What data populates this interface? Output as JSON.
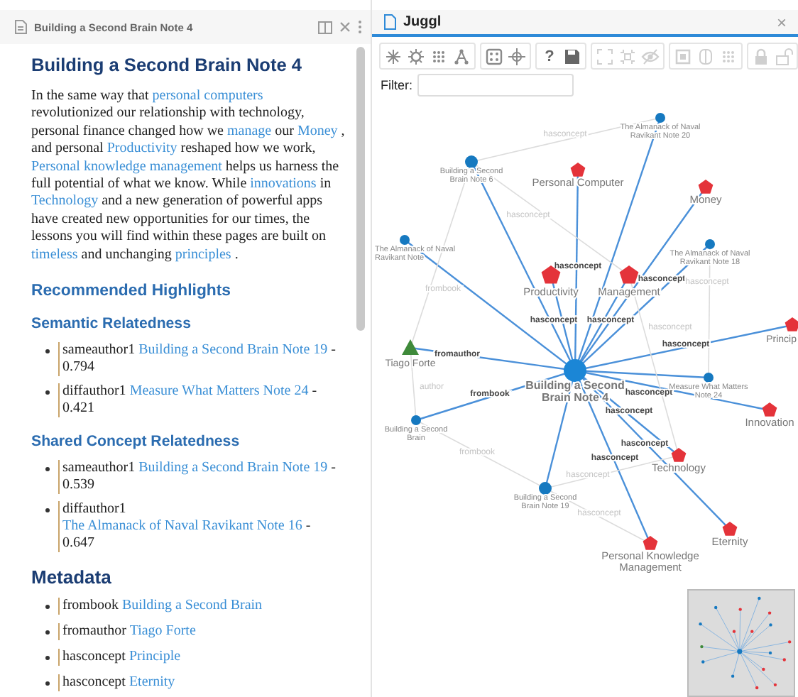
{
  "note_tab": {
    "title": "Building a Second Brain Note 4"
  },
  "note": {
    "title": "Building a Second Brain Note 4",
    "paragraph": [
      {
        "kind": "text",
        "text": "In the same way that "
      },
      {
        "kind": "link",
        "text": "personal computers"
      },
      {
        "kind": "text",
        "text": " revolutionized our relationship with technology, personal finance changed how we "
      },
      {
        "kind": "link",
        "text": "manage"
      },
      {
        "kind": "text",
        "text": " our "
      },
      {
        "kind": "link",
        "text": "Money"
      },
      {
        "kind": "text",
        "text": " , and personal "
      },
      {
        "kind": "link",
        "text": "Productivity"
      },
      {
        "kind": "text",
        "text": " reshaped how we work, "
      },
      {
        "kind": "link",
        "text": "Personal knowledge management"
      },
      {
        "kind": "text",
        "text": " helps us harness the full potential of what we know. While "
      },
      {
        "kind": "link",
        "text": "innovations"
      },
      {
        "kind": "text",
        "text": " in "
      },
      {
        "kind": "link",
        "text": "Technology"
      },
      {
        "kind": "text",
        "text": " and a new generation of powerful apps have created new opportunities for our times, the lessons you will find within these pages are built on "
      },
      {
        "kind": "link",
        "text": "timeless"
      },
      {
        "kind": "text",
        "text": " and unchanging "
      },
      {
        "kind": "link",
        "text": "principles"
      },
      {
        "kind": "text",
        "text": " ."
      }
    ],
    "highlights_heading": "Recommended Highlights",
    "sections": [
      {
        "heading": "Semantic Relatedness",
        "items": [
          {
            "relation": "sameauthor1",
            "link": "Building a Second Brain Note 19",
            "score": "- 0.794"
          },
          {
            "relation": "diffauthor1",
            "link": "Measure What Matters Note 24",
            "score": "- 0.421"
          }
        ]
      },
      {
        "heading": "Shared Concept Relatedness",
        "items": [
          {
            "relation": "sameauthor1",
            "link": "Building a Second Brain Note 19",
            "score": "- 0.539"
          },
          {
            "relation": "diffauthor1",
            "link": "The Almanack of Naval Ravikant Note 16",
            "score": "- 0.647"
          }
        ]
      }
    ],
    "metadata_heading": "Metadata",
    "metadata": [
      {
        "key": "frombook",
        "value": "Building a Second Brain"
      },
      {
        "key": "fromauthor",
        "value": "Tiago Forte"
      },
      {
        "key": "hasconcept",
        "value": "Principle"
      },
      {
        "key": "hasconcept",
        "value": "Eternity"
      }
    ]
  },
  "graph_tab": {
    "title": "Juggl",
    "close": "×"
  },
  "toolbar": [
    {
      "buttons": [
        {
          "kind": "sparkle",
          "disabled": false
        },
        {
          "kind": "gear",
          "disabled": false
        },
        {
          "kind": "grid",
          "disabled": false
        },
        {
          "kind": "tree",
          "disabled": false
        }
      ]
    },
    {
      "buttons": [
        {
          "kind": "dice",
          "disabled": false
        },
        {
          "kind": "crosshair",
          "disabled": false
        }
      ]
    },
    {
      "buttons": [
        {
          "kind": "help",
          "label": "?",
          "disabled": false
        },
        {
          "kind": "save",
          "disabled": false
        }
      ]
    },
    {
      "buttons": [
        {
          "kind": "expand",
          "disabled": true
        },
        {
          "kind": "shrink",
          "disabled": true
        },
        {
          "kind": "eye",
          "disabled": true
        }
      ]
    },
    {
      "buttons": [
        {
          "kind": "square",
          "disabled": true
        },
        {
          "kind": "columns",
          "disabled": true
        },
        {
          "kind": "grid",
          "disabled": true
        }
      ]
    },
    {
      "buttons": [
        {
          "kind": "lock",
          "disabled": true
        },
        {
          "kind": "unlock",
          "disabled": true
        }
      ]
    }
  ],
  "filter": {
    "label": "Filter:"
  },
  "graph": {
    "nodes": [
      {
        "label": "Building a Second Brain Note 4",
        "kind": "current"
      },
      {
        "label": "The Almanack of Naval Ravikant Note 20",
        "kind": "note"
      },
      {
        "label": "Building a Second Brain Note 6",
        "kind": "note"
      },
      {
        "label": "Personal Computer",
        "kind": "concept"
      },
      {
        "label": "Money",
        "kind": "concept"
      },
      {
        "label": "The Almanack of Naval Ravikant Note",
        "kind": "note"
      },
      {
        "label": "The Almanack of Naval Ravikant Note 18",
        "kind": "note"
      },
      {
        "label": "Productivity",
        "kind": "concept"
      },
      {
        "label": "Management",
        "kind": "concept"
      },
      {
        "label": "Princip",
        "kind": "concept"
      },
      {
        "label": "Tiago Forte",
        "kind": "author"
      },
      {
        "label": "Measure What Matters Note 24",
        "kind": "note"
      },
      {
        "label": "Innovation",
        "kind": "concept"
      },
      {
        "label": "Building a Second Brain",
        "kind": "note"
      },
      {
        "label": "Technology",
        "kind": "concept"
      },
      {
        "label": "Building a Second Brain Note 19",
        "kind": "note"
      },
      {
        "label": "Eternity",
        "kind": "concept"
      },
      {
        "label": "Personal Knowledge Management",
        "kind": "concept"
      }
    ],
    "edges": [
      {
        "highlighted": true
      },
      {
        "highlighted": true
      },
      {
        "label": "hasconcept",
        "highlighted": true
      },
      {
        "label": "hasconcept",
        "highlighted": true
      },
      {
        "highlighted": true
      },
      {
        "highlighted": true
      },
      {
        "label": "hasconcept",
        "highlighted": true
      },
      {
        "label": "hasconcept",
        "highlighted": true
      },
      {
        "label": "hasconcept",
        "highlighted": true
      },
      {
        "label": "fromauthor",
        "highlighted": true
      },
      {
        "highlighted": true
      },
      {
        "label": "hasconcept",
        "highlighted": true
      },
      {
        "label": "frombook",
        "highlighted": true
      },
      {
        "label": "hasconcept",
        "highlighted": true
      },
      {
        "highlighted": true
      },
      {
        "label": "hasconcept",
        "highlighted": true
      },
      {
        "label": "hasconcept",
        "highlighted": true
      },
      {
        "label": "hasconcept",
        "highlighted": false
      },
      {
        "label": "hasconcept",
        "highlighted": false
      },
      {
        "label": "frombook",
        "highlighted": false
      },
      {
        "label": "hasconcept",
        "highlighted": false
      },
      {
        "label": "hasconcept",
        "highlighted": false
      },
      {
        "label": "author",
        "highlighted": false
      },
      {
        "label": "frombook",
        "highlighted": false
      },
      {
        "label": "hasconcept",
        "highlighted": false
      },
      {
        "label": "hasconcept",
        "highlighted": false
      }
    ]
  }
}
